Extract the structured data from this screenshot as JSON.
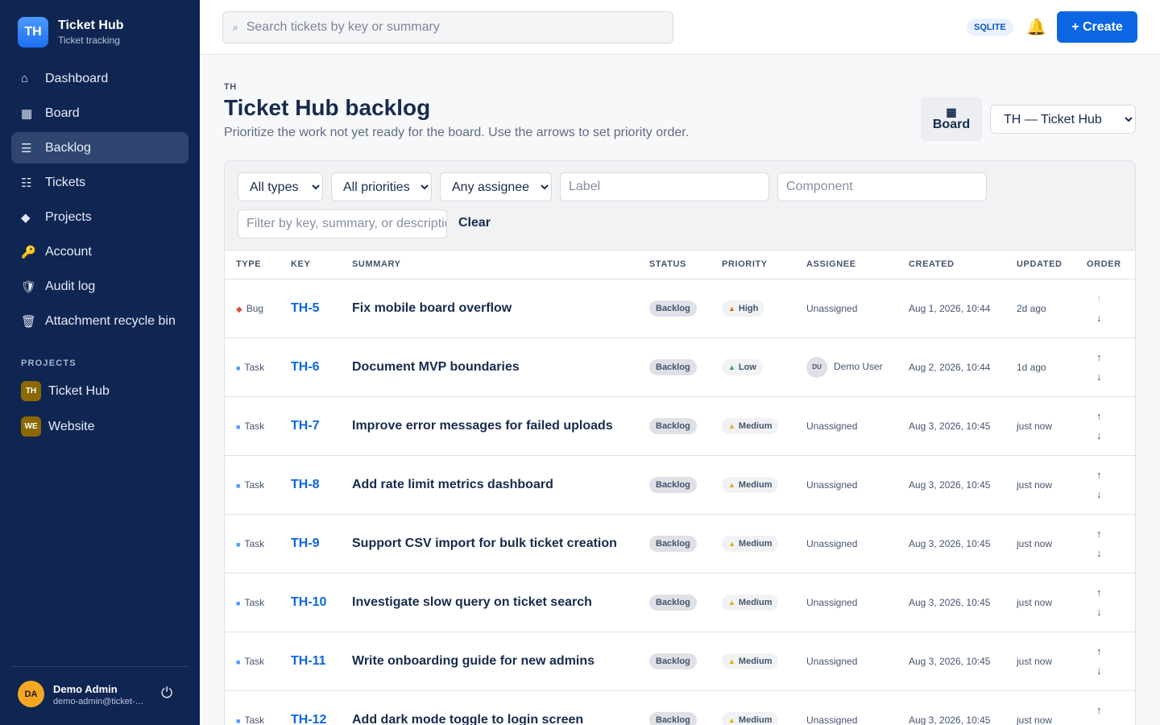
{
  "brand": {
    "logo": "TH",
    "name": "Ticket Hub",
    "subtitle": "Ticket tracking"
  },
  "nav": [
    {
      "label": "Dashboard",
      "icon": "⌂",
      "icon_name": "home-icon"
    },
    {
      "label": "Board",
      "icon": "▦",
      "icon_name": "board-icon"
    },
    {
      "label": "Backlog",
      "icon": "☰",
      "icon_name": "list-icon",
      "active": true
    },
    {
      "label": "Tickets",
      "icon": "☷",
      "icon_name": "tickets-icon"
    },
    {
      "label": "Projects",
      "icon": "◆",
      "icon_name": "diamond-icon"
    },
    {
      "label": "Account",
      "icon": "🔑",
      "icon_name": "key-icon"
    },
    {
      "label": "Audit log",
      "icon": "🛡",
      "icon_name": "shield-icon"
    },
    {
      "label": "Attachment recycle bin",
      "icon": "🗑",
      "icon_name": "trash-icon"
    }
  ],
  "projects_heading": "PROJECTS",
  "projects": [
    {
      "badge": "TH",
      "name": "Ticket Hub"
    },
    {
      "badge": "WE",
      "name": "Website"
    }
  ],
  "user": {
    "initials": "DA",
    "name": "Demo Admin",
    "email": "demo-admin@ticket-hub.local"
  },
  "topbar": {
    "search_placeholder": "Search tickets by key or summary",
    "db_badge": "SQLITE",
    "create_label": "+ Create"
  },
  "header": {
    "crumb": "TH",
    "title": "Ticket Hub backlog",
    "description": "Prioritize the work not yet ready for the board. Use the arrows to set priority order.",
    "board_label": "Board",
    "project_select": "TH — Ticket Hub"
  },
  "filters": {
    "type": "All types",
    "priority": "All priorities",
    "assignee": "Any assignee",
    "label_placeholder": "Label",
    "component_placeholder": "Component",
    "text_placeholder": "Filter by key, summary, or description",
    "clear_label": "Clear"
  },
  "columns": [
    "TYPE",
    "KEY",
    "SUMMARY",
    "STATUS",
    "PRIORITY",
    "ASSIGNEE",
    "CREATED",
    "UPDATED",
    "ORDER"
  ],
  "rows": [
    {
      "type": "Bug",
      "key": "TH-5",
      "summary": "Fix mobile board overflow",
      "status": "Backlog",
      "priority": "High",
      "assignee": "Unassigned",
      "assignee_initials": "",
      "created": "Aug 1, 2026, 10:44",
      "updated": "2d ago",
      "first": true
    },
    {
      "type": "Task",
      "key": "TH-6",
      "summary": "Document MVP boundaries",
      "status": "Backlog",
      "priority": "Low",
      "assignee": "Demo User",
      "assignee_initials": "DU",
      "created": "Aug 2, 2026, 10:44",
      "updated": "1d ago"
    },
    {
      "type": "Task",
      "key": "TH-7",
      "summary": "Improve error messages for failed uploads",
      "status": "Backlog",
      "priority": "Medium",
      "assignee": "Unassigned",
      "assignee_initials": "",
      "created": "Aug 3, 2026, 10:45",
      "updated": "just now"
    },
    {
      "type": "Task",
      "key": "TH-8",
      "summary": "Add rate limit metrics dashboard",
      "status": "Backlog",
      "priority": "Medium",
      "assignee": "Unassigned",
      "assignee_initials": "",
      "created": "Aug 3, 2026, 10:45",
      "updated": "just now"
    },
    {
      "type": "Task",
      "key": "TH-9",
      "summary": "Support CSV import for bulk ticket creation",
      "status": "Backlog",
      "priority": "Medium",
      "assignee": "Unassigned",
      "assignee_initials": "",
      "created": "Aug 3, 2026, 10:45",
      "updated": "just now"
    },
    {
      "type": "Task",
      "key": "TH-10",
      "summary": "Investigate slow query on ticket search",
      "status": "Backlog",
      "priority": "Medium",
      "assignee": "Unassigned",
      "assignee_initials": "",
      "created": "Aug 3, 2026, 10:45",
      "updated": "just now"
    },
    {
      "type": "Task",
      "key": "TH-11",
      "summary": "Write onboarding guide for new admins",
      "status": "Backlog",
      "priority": "Medium",
      "assignee": "Unassigned",
      "assignee_initials": "",
      "created": "Aug 3, 2026, 10:45",
      "updated": "just now"
    },
    {
      "type": "Task",
      "key": "TH-12",
      "summary": "Add dark mode toggle to login screen",
      "status": "Backlog",
      "priority": "Medium",
      "assignee": "Unassigned",
      "assignee_initials": "",
      "created": "Aug 3, 2026, 10:45",
      "updated": "just now"
    }
  ],
  "colors": {
    "sidebar": "#0f2552",
    "accent": "#0c66e4",
    "bug": "#e34935",
    "task": "#4c9aff",
    "high": "#e56910",
    "low": "#22a06b",
    "medium": "#e2b203"
  }
}
